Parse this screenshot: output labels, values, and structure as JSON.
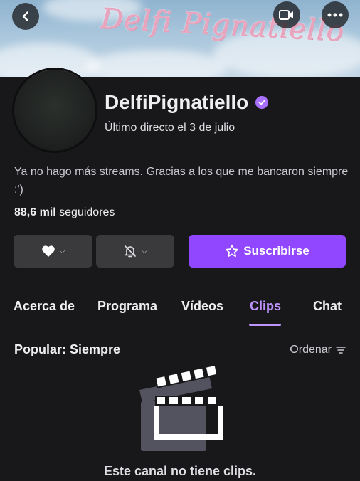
{
  "banner": {
    "script_text": "Delfi Pignatiello",
    "back_icon": "chevron-left-icon",
    "video_icon": "video-camera-icon",
    "more_icon": "more-horizontal-icon"
  },
  "channel": {
    "name": "DelfiPignatiello",
    "verified_icon": "verified-badge-icon",
    "last_live": "Último directo el 3 de julio",
    "bio": "Ya no hago más streams. Gracias a los que me bancaron siempre :')",
    "followers_count": "88,6 mil",
    "followers_label": "seguidores"
  },
  "actions": {
    "follow_icon": "heart-icon",
    "notifications_icon": "bell-off-icon",
    "subscribe_label": "Suscribirse",
    "subscribe_icon": "star-icon"
  },
  "tabs": [
    {
      "label": "Acerca de",
      "active": false
    },
    {
      "label": "Programa",
      "active": false
    },
    {
      "label": "Vídeos",
      "active": false
    },
    {
      "label": "Clips",
      "active": true
    },
    {
      "label": "Chat",
      "active": false
    }
  ],
  "clips": {
    "section_title": "Popular: Siempre",
    "sort_label": "Ordenar",
    "sort_icon": "sort-lines-icon",
    "empty_icon": "clapperboard-icon",
    "empty_message": "Este canal no tiene clips."
  },
  "colors": {
    "accent": "#9147ff",
    "accent_light": "#bf94ff",
    "background": "#18181b",
    "button_gray": "#3a3a3d"
  }
}
